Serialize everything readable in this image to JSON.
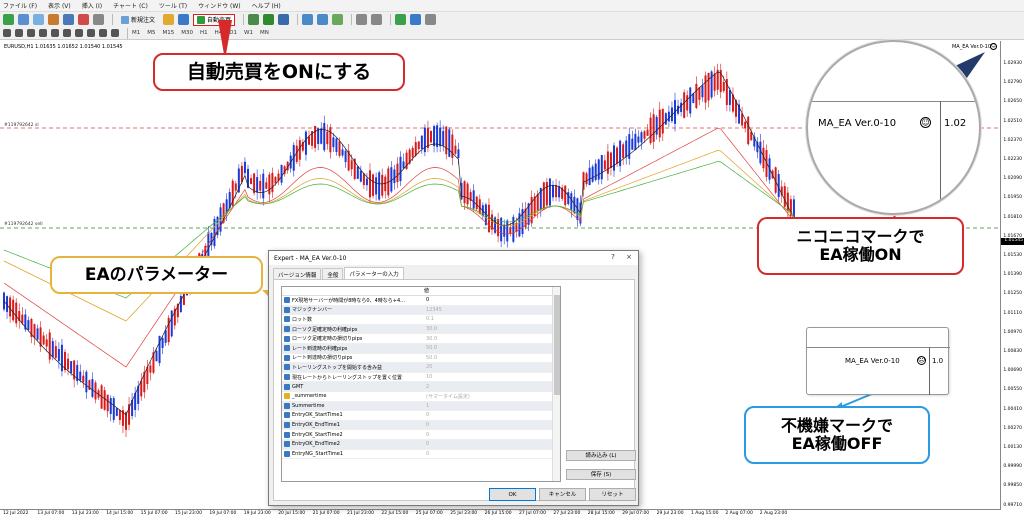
{
  "menubar": {
    "items": [
      "ファイル (F)",
      "表示 (V)",
      "挿入 (I)",
      "チャート (C)",
      "ツール (T)",
      "ウィンドウ (W)",
      "ヘルプ (H)"
    ]
  },
  "toolbar": {
    "new_order": "新規注文",
    "auto_trade": "自動売買",
    "timeframes": [
      "M1",
      "M5",
      "M15",
      "M30",
      "H1",
      "H4",
      "D1",
      "W1",
      "MN"
    ]
  },
  "chart": {
    "symbol_info": "EURUSD,H1  1.01635 1.01652 1.01540 1.01545",
    "ea_label": "MA_EA Ver.0-10",
    "current_price": "1.01545",
    "hline_labels": [
      "#119792642 sl",
      "#119792642 sell"
    ],
    "price_ticks": [
      "1.02930",
      "1.02790",
      "1.02650",
      "1.02510",
      "1.02370",
      "1.02230",
      "1.02090",
      "1.01950",
      "1.01810",
      "1.01670",
      "1.01530",
      "1.01390",
      "1.01250",
      "1.01110",
      "1.00970",
      "1.00830",
      "1.00690",
      "1.00550",
      "1.00410",
      "1.00270",
      "1.00130",
      "0.99990",
      "0.99850",
      "0.99710"
    ],
    "date_ticks": [
      "12 Jul 2022",
      "13 Jul 07:00",
      "13 Jul 23:00",
      "14 Jul 15:00",
      "15 Jul 07:00",
      "15 Jul 23:00",
      "19 Jul 07:00",
      "19 Jul 23:00",
      "20 Jul 15:00",
      "21 Jul 07:00",
      "21 Jul 23:00",
      "22 Jul 15:00",
      "25 Jul 07:00",
      "25 Jul 23:00",
      "26 Jul 15:00",
      "27 Jul 07:00",
      "27 Jul 23:00",
      "28 Jul 15:00",
      "29 Jul 07:00",
      "29 Jul 23:00",
      "1 Aug 15:00",
      "2 Aug 07:00",
      "2 Aug 23:00"
    ]
  },
  "callouts": {
    "auto_trade_on": "自動売買をONにする",
    "ea_params": "EAのパラメーター",
    "smile_on_line1": "ニコニコマークで",
    "smile_on_line2": "EA稼働ON",
    "frown_off_line1": "不機嫌マークで",
    "frown_off_line2": "EA稼働OFF"
  },
  "zoom_inset": {
    "label": "MA_EA Ver.0-10",
    "price_fragment": "1.02"
  },
  "off_inset": {
    "label": "MA_EA Ver.0-10",
    "price_fragment": "1.0"
  },
  "dialog": {
    "title": "Expert - MA_EA Ver.0-10",
    "title_controls": [
      "?",
      "×"
    ],
    "tabs": [
      "バージョン情報",
      "全般",
      "パラメーターの入力"
    ],
    "value_header": "値",
    "params": [
      {
        "name": "FX現地サーバーが時間が8時なら0、4時なら+4...",
        "value": "0",
        "icon": "num",
        "dark": true
      },
      {
        "name": "マジックナンバー",
        "value": "12345",
        "icon": "num",
        "dark": false
      },
      {
        "name": "ロット数",
        "value": "0.1",
        "icon": "num",
        "dark": false
      },
      {
        "name": "ローソク足確定時の利確pips",
        "value": "30.0",
        "icon": "num",
        "dark": false
      },
      {
        "name": "ローソク足確定時の損切りpips",
        "value": "30.0",
        "icon": "num",
        "dark": false
      },
      {
        "name": "レート到達時の利確pips",
        "value": "50.0",
        "icon": "num",
        "dark": false
      },
      {
        "name": "レート到達時の損切りpips",
        "value": "50.0",
        "icon": "num",
        "dark": false
      },
      {
        "name": "トレーリングストップを開始する含み益",
        "value": "20",
        "icon": "num",
        "dark": false
      },
      {
        "name": "現在レートからトレーリングストップを置く位置",
        "value": "10",
        "icon": "num",
        "dark": false
      },
      {
        "name": "GMT",
        "value": "2",
        "icon": "num",
        "dark": false
      },
      {
        "name": "_summertime",
        "value": "(サマータイム設定)",
        "icon": "ab",
        "dark": false
      },
      {
        "name": "Summertime",
        "value": "1",
        "icon": "num",
        "dark": false
      },
      {
        "name": "EntryOK_StartTime1",
        "value": "0",
        "icon": "num",
        "dark": false
      },
      {
        "name": "EntryOK_EndTime1",
        "value": "0",
        "icon": "num",
        "dark": false
      },
      {
        "name": "EntryOK_StartTime2",
        "value": "0",
        "icon": "num",
        "dark": false
      },
      {
        "name": "EntryOK_EndTime2",
        "value": "0",
        "icon": "num",
        "dark": false
      },
      {
        "name": "EntryNG_StartTime1",
        "value": "0",
        "icon": "num",
        "dark": false
      }
    ],
    "load_button": "読み込み (L)",
    "save_button": "保存 (S)",
    "ok_button": "OK",
    "cancel_button": "キャンセル",
    "reset_button": "リセット"
  }
}
